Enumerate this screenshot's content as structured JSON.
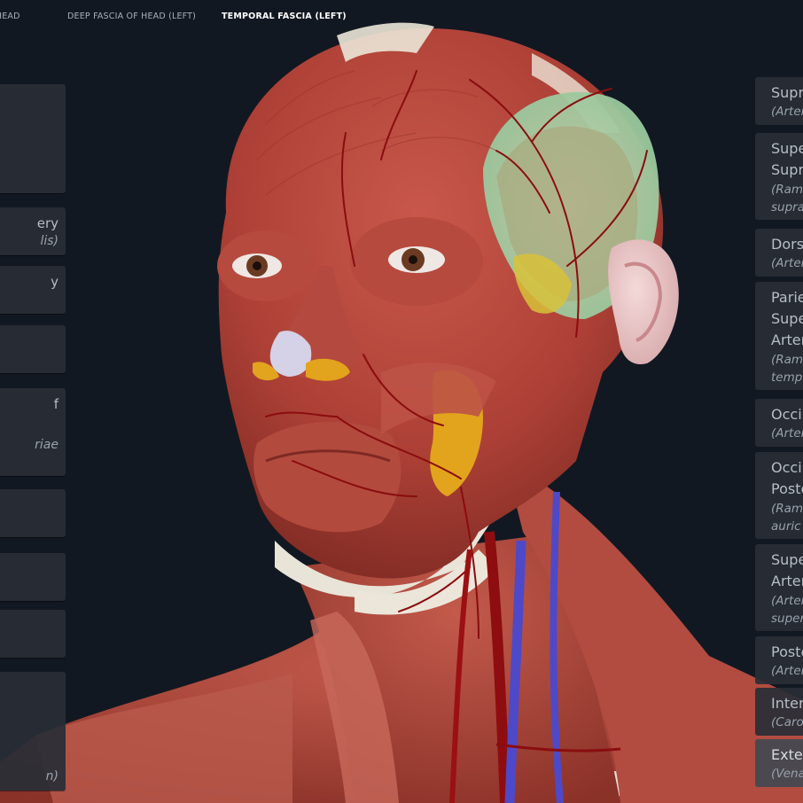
{
  "breadcrumb": {
    "items": [
      {
        "label": "F HEAD"
      },
      {
        "label": "DEEP FASCIA OF HEAD (LEFT)"
      },
      {
        "label": "TEMPORAL FASCIA (LEFT)"
      }
    ]
  },
  "left_labels": [
    {
      "title": "",
      "subtitle": ""
    },
    {
      "title": "ery",
      "subtitle": "lis)"
    },
    {
      "title": "y",
      "subtitle": ""
    },
    {
      "title": "",
      "subtitle": ""
    },
    {
      "title": "f",
      "subtitle": "riae"
    },
    {
      "title": "",
      "subtitle": ""
    },
    {
      "title": "",
      "subtitle": ""
    },
    {
      "title": "",
      "subtitle": ""
    },
    {
      "title": "",
      "subtitle": "n)"
    }
  ],
  "right_labels": [
    {
      "lines": [
        "Supr"
      ],
      "sub": [
        "(Arter"
      ]
    },
    {
      "lines": [
        "Supe",
        "Supr"
      ],
      "sub": [
        "(Ram",
        "supra"
      ]
    },
    {
      "lines": [
        "Dors"
      ],
      "sub": [
        "(Arter"
      ]
    },
    {
      "lines": [
        "Parie",
        "Supe",
        "Arter"
      ],
      "sub": [
        "(Ram",
        "temp"
      ]
    },
    {
      "lines": [
        "Occi"
      ],
      "sub": [
        "(Arter"
      ]
    },
    {
      "lines": [
        "Occip",
        "Poste"
      ],
      "sub": [
        "(Ram",
        "auric"
      ]
    },
    {
      "lines": [
        "Supe",
        "Arter"
      ],
      "sub": [
        "(Arter",
        "super"
      ]
    },
    {
      "lines": [
        "Poste"
      ],
      "sub": [
        "(Arter"
      ]
    },
    {
      "lines": [
        "Inter"
      ],
      "sub": [
        "(Caro"
      ]
    },
    {
      "lines": [
        "Exter"
      ],
      "sub": [
        "(Vena"
      ]
    }
  ],
  "colors": {
    "background": "#121821",
    "muscle": "#b5483d",
    "artery": "#8a0d0f",
    "vein": "#4e49c8",
    "bone": "#e6e0d3",
    "fascia": "#a8d6a0",
    "fat": "#e2a41c",
    "card": "#282e36"
  },
  "icons": {
    "model": "3d-head-neck-anatomy-model"
  }
}
